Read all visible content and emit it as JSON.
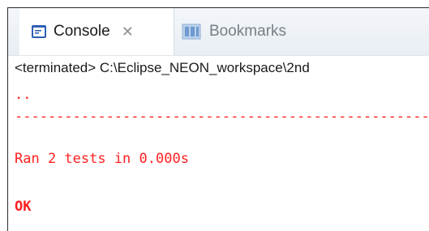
{
  "tabs": {
    "console_label": "Console",
    "console_close": "✕",
    "bookmarks_label": "Bookmarks"
  },
  "status_line": "<terminated> C:\\Eclipse_NEON_workspace\\2nd",
  "console_output": [
    "..",
    "----------------------------------------------------------------------",
    "Ran 2 tests in 0.000s",
    "",
    "OK"
  ],
  "colors": {
    "console_text": "#ff1f1f"
  }
}
